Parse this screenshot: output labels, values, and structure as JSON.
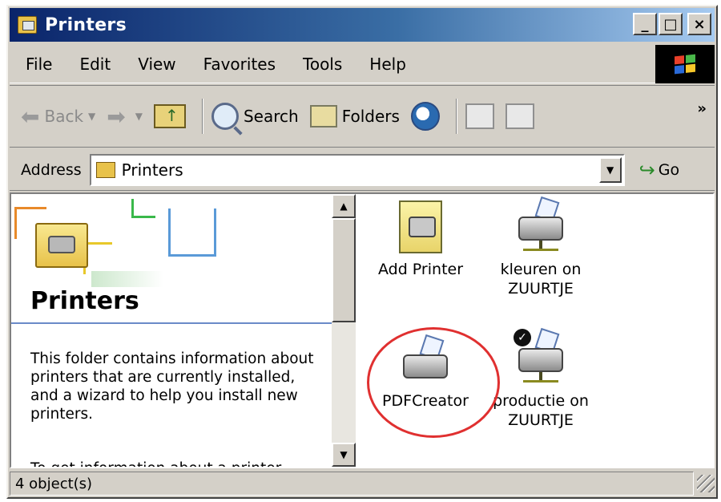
{
  "window": {
    "title": "Printers"
  },
  "menu": {
    "items": [
      {
        "label": "File",
        "accel": "F"
      },
      {
        "label": "Edit",
        "accel": "E"
      },
      {
        "label": "View",
        "accel": "V"
      },
      {
        "label": "Favorites",
        "accel": "a"
      },
      {
        "label": "Tools",
        "accel": "T"
      },
      {
        "label": "Help",
        "accel": "H"
      }
    ]
  },
  "toolbar": {
    "back_label": "Back",
    "search_label": "Search",
    "folders_label": "Folders",
    "more_label": "»"
  },
  "address": {
    "label": "Address",
    "value": "Printers",
    "go_label": "Go"
  },
  "leftpane": {
    "title": "Printers",
    "description": "This folder contains information about printers that are currently installed, and a wizard to help you install new printers.",
    "more_text": "To get information about a printer"
  },
  "items": [
    {
      "label": "Add Printer",
      "icon": "add-printer-icon"
    },
    {
      "label": "kleuren on ZUURTJE",
      "icon": "network-printer-icon"
    },
    {
      "label": "PDFCreator",
      "icon": "printer-icon"
    },
    {
      "label": "productie on ZUURTJE",
      "icon": "network-printer-default-icon"
    }
  ],
  "status": {
    "text": "4 object(s)"
  },
  "colors": {
    "titlebar_start": "#0a246a",
    "titlebar_end": "#a6caf0",
    "face": "#d4d0c8",
    "highlight_circle": "#e03030"
  }
}
